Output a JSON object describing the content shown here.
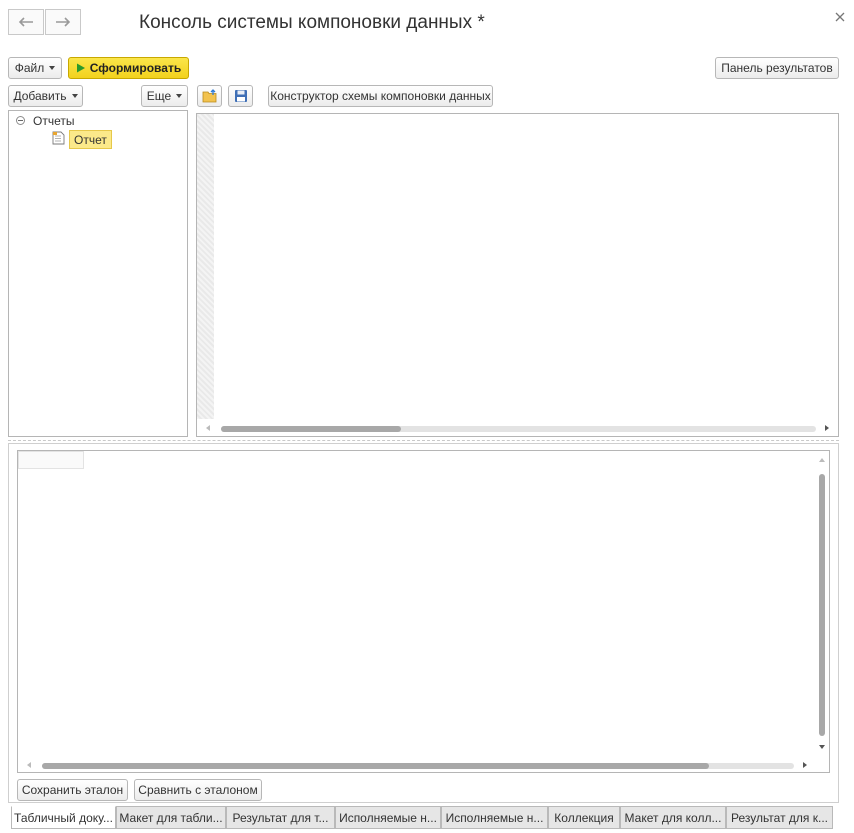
{
  "window": {
    "title": "Консоль системы компоновки данных *"
  },
  "toolbar": {
    "file_label": "Файл",
    "generate_label": "Сформировать",
    "results_panel_label": "Панель результатов"
  },
  "tree_toolbar": {
    "add_label": "Добавить",
    "more_label": "Еще",
    "constructor_label": "Конструктор схемы компоновки данных"
  },
  "tree": {
    "root_label": "Отчеты",
    "child_label": "Отчет"
  },
  "bottom_buttons": {
    "save_reference_label": "Сохранить эталон",
    "compare_reference_label": "Сравнить с эталоном"
  },
  "tabs": [
    {
      "label": "Табличный доку...",
      "active": true
    },
    {
      "label": "Макет для табли...",
      "active": false
    },
    {
      "label": "Результат для т...",
      "active": false
    },
    {
      "label": "Исполняемые н...",
      "active": false
    },
    {
      "label": "Исполняемые н...",
      "active": false
    },
    {
      "label": "Коллекция",
      "active": false
    },
    {
      "label": "Макет для колл...",
      "active": false
    },
    {
      "label": "Результат для к...",
      "active": false
    }
  ],
  "colors": {
    "accent": "#f5dd2b",
    "selection": "#fbe98a",
    "border": "#b5b5b5"
  }
}
